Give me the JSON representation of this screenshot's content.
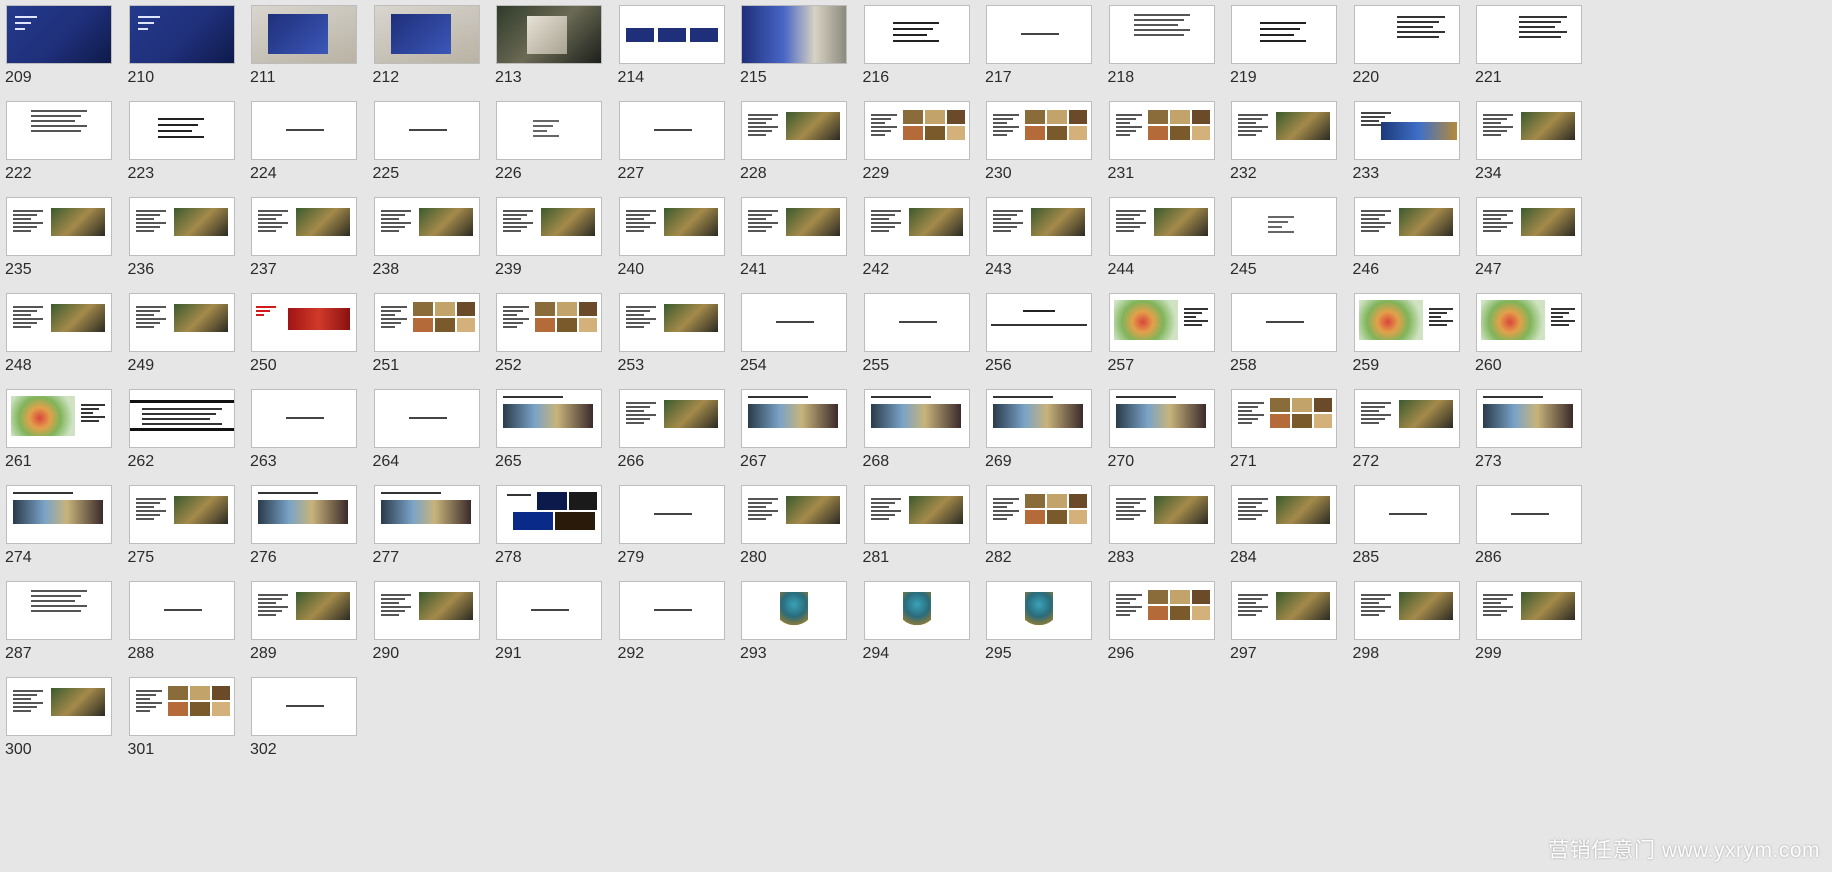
{
  "slide_numbers": [
    "209",
    "210",
    "211",
    "212",
    "213",
    "214",
    "215",
    "216",
    "217",
    "218",
    "219",
    "220",
    "221",
    "222",
    "223",
    "224",
    "225",
    "226",
    "227",
    "228",
    "229",
    "230",
    "231",
    "232",
    "233",
    "234",
    "235",
    "236",
    "237",
    "238",
    "239",
    "240",
    "241",
    "242",
    "243",
    "244",
    "245",
    "246",
    "247",
    "248",
    "249",
    "250",
    "251",
    "252",
    "253",
    "254",
    "255",
    "256",
    "257",
    "258",
    "259",
    "260",
    "261",
    "262",
    "263",
    "264",
    "265",
    "266",
    "267",
    "268",
    "269",
    "270",
    "271",
    "272",
    "273",
    "274",
    "275",
    "276",
    "277",
    "278",
    "279",
    "280",
    "281",
    "282",
    "283",
    "284",
    "285",
    "286",
    "287",
    "288",
    "289",
    "290",
    "291",
    "292",
    "293",
    "294",
    "295",
    "296",
    "297",
    "298",
    "299",
    "300",
    "301",
    "302"
  ],
  "watermark": "营销任意门 www.yxrym.com",
  "colors": {
    "background": "#e6e6e6",
    "slide_bg": "#ffffff",
    "accent_blue": "#1f2f7a",
    "accent_red": "#d11a1a"
  }
}
